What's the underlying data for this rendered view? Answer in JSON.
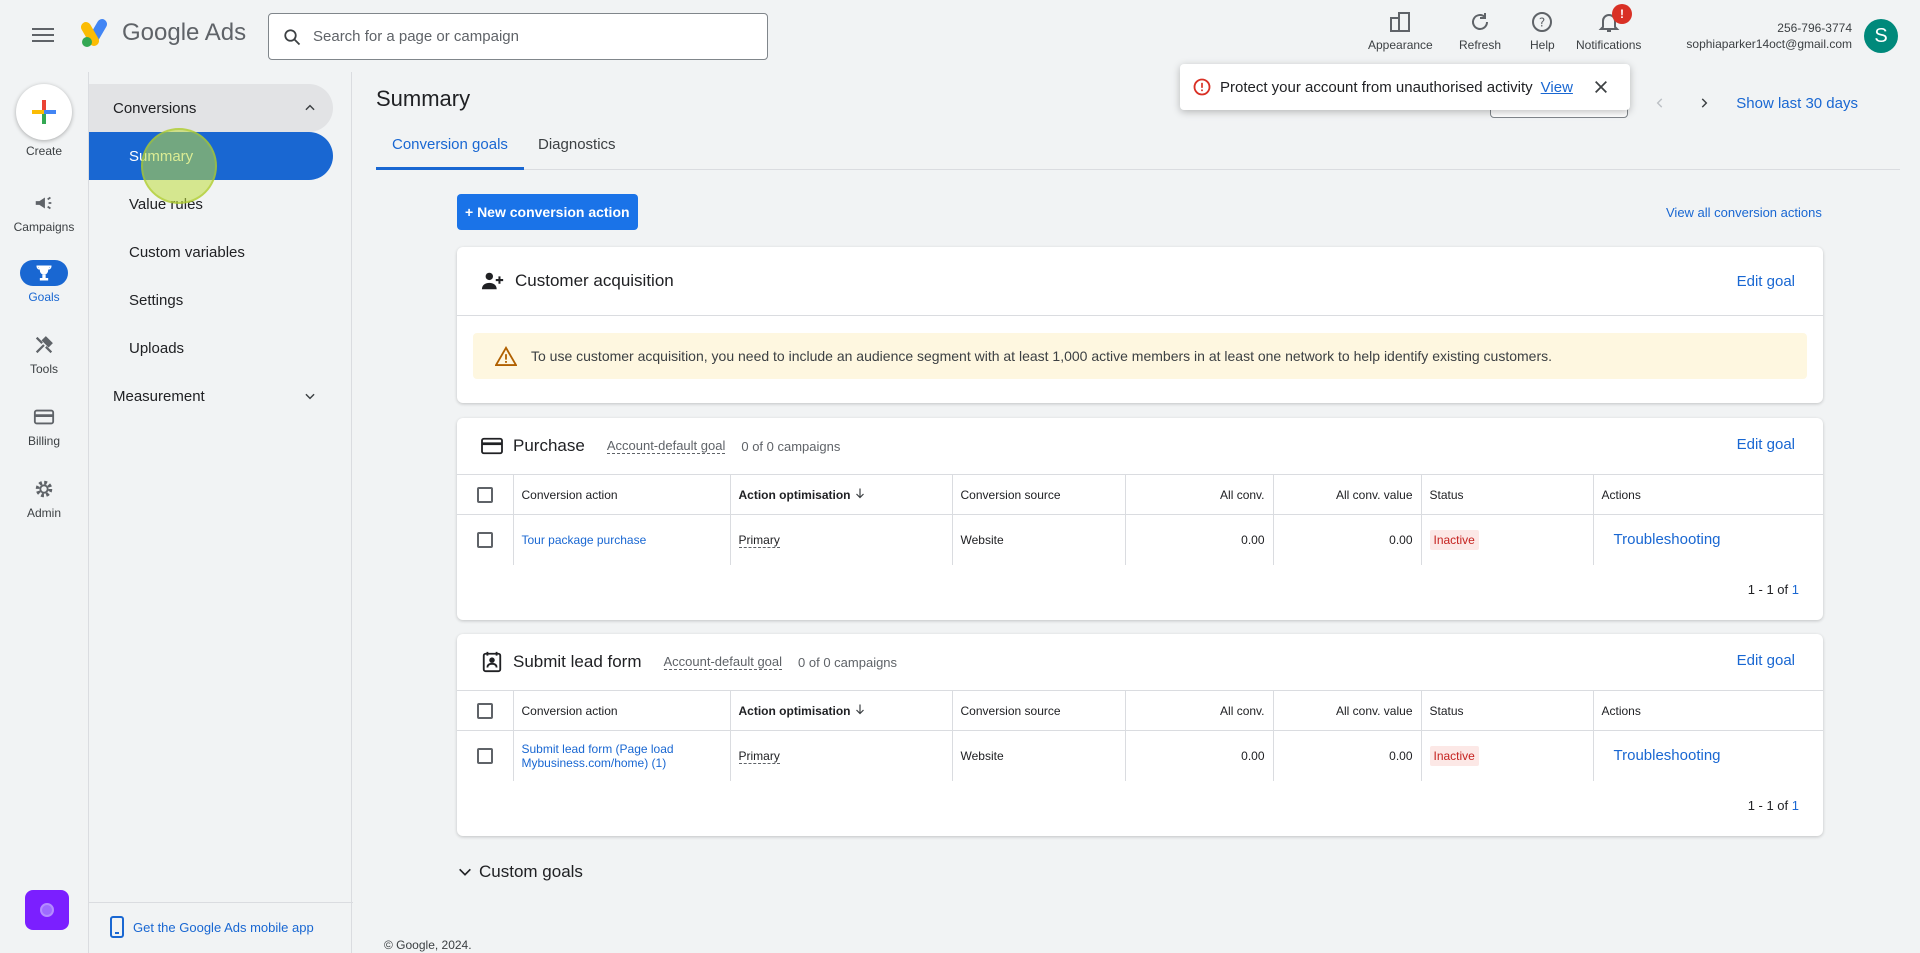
{
  "app": {
    "logo_text": "Google Ads"
  },
  "search": {
    "placeholder": "Search for a page or campaign"
  },
  "header_actions": [
    {
      "label": "Appearance",
      "icon": "appearance-icon"
    },
    {
      "label": "Refresh",
      "icon": "refresh-icon"
    },
    {
      "label": "Help",
      "icon": "help-icon"
    },
    {
      "label": "Notifications",
      "icon": "bell-icon",
      "badge": "!"
    }
  ],
  "account": {
    "phone": "256-796-3774",
    "email": "sophiaparker14oct@gmail.com",
    "avatar_letter": "S"
  },
  "rail": {
    "create_label": "Create",
    "items": [
      {
        "label": "Campaigns",
        "icon": "megaphone-icon"
      },
      {
        "label": "Goals",
        "icon": "trophy-icon",
        "active": true
      },
      {
        "label": "Tools",
        "icon": "tools-icon"
      },
      {
        "label": "Billing",
        "icon": "credit-card-icon"
      },
      {
        "label": "Admin",
        "icon": "gear-icon"
      }
    ]
  },
  "subnav": {
    "group_conversions": "Conversions",
    "items": [
      "Summary",
      "Value rules",
      "Custom variables",
      "Settings",
      "Uploads"
    ],
    "group_measurement": "Measurement",
    "mobile_app": "Get the Google Ads mobile app"
  },
  "page": {
    "title": "Summary",
    "tabs": [
      "Conversion goals",
      "Diagnostics"
    ],
    "show_last": "Show last 30 days",
    "new_conversion": "+ New conversion action",
    "view_all": "View all conversion actions"
  },
  "toast": {
    "text": "Protect your account from unauthorised activity",
    "link": "View"
  },
  "customer_acquisition": {
    "title": "Customer acquisition",
    "edit": "Edit goal",
    "warning": "To use customer acquisition, you need to include an audience segment with at least 1,000 active members in at least one network to help identify existing customers."
  },
  "table_headers": [
    "Conversion action",
    "Action optimisation",
    "Conversion source",
    "All conv.",
    "All conv. value",
    "Status",
    "Actions"
  ],
  "purchase": {
    "title": "Purchase",
    "tag": "Account-default goal",
    "campaigns": "0 of 0 campaigns",
    "edit": "Edit goal",
    "row": {
      "action": "Tour package purchase",
      "optimisation": "Primary",
      "source": "Website",
      "all_conv": "0.00",
      "all_conv_value": "0.00",
      "status": "Inactive",
      "actions": "Troubleshooting"
    },
    "pager_prefix": "1 - 1 of ",
    "pager_total": "1"
  },
  "lead": {
    "title": "Submit lead form",
    "tag": "Account-default goal",
    "campaigns": "0 of 0 campaigns",
    "edit": "Edit goal",
    "row": {
      "action": "Submit lead form (Page load Mybusiness.com/home) (1)",
      "optimisation": "Primary",
      "source": "Website",
      "all_conv": "0.00",
      "all_conv_value": "0.00",
      "status": "Inactive",
      "actions": "Troubleshooting"
    },
    "pager_prefix": "1 - 1 of ",
    "pager_total": "1"
  },
  "custom_goals": "Custom goals",
  "footer": "© Google, 2024."
}
